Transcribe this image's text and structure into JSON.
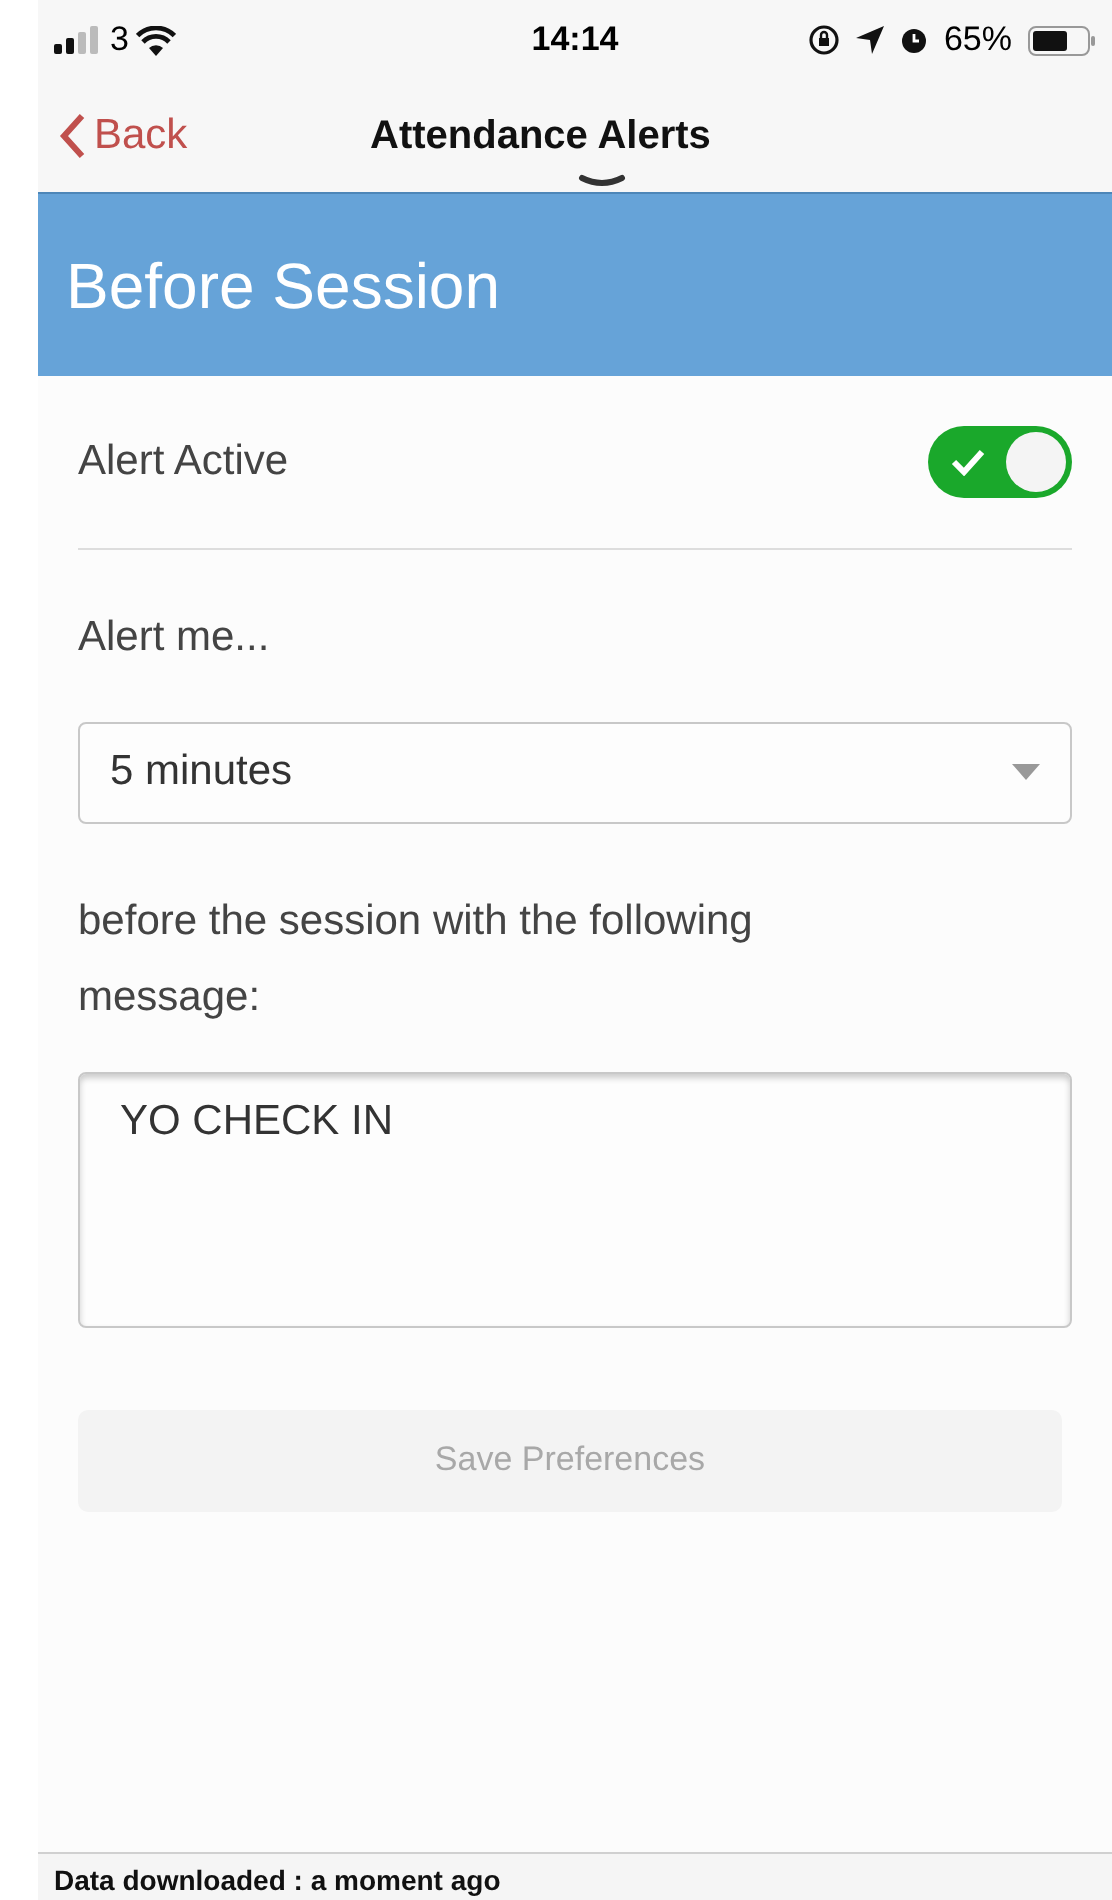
{
  "status_bar": {
    "carrier": "3",
    "time": "14:14",
    "battery": "65%"
  },
  "nav": {
    "back": "Back",
    "title": "Attendance Alerts"
  },
  "header": {
    "title": "Before Session"
  },
  "alert_active": {
    "label": "Alert Active",
    "on": true
  },
  "alert_me": {
    "label": "Alert me...",
    "value": "5 minutes"
  },
  "message": {
    "label": "before the session with the following message:",
    "value": "YO CHECK IN"
  },
  "save_button": {
    "label": "Save Preferences",
    "disabled": true
  },
  "footer": {
    "text": "Data downloaded : a moment ago"
  }
}
